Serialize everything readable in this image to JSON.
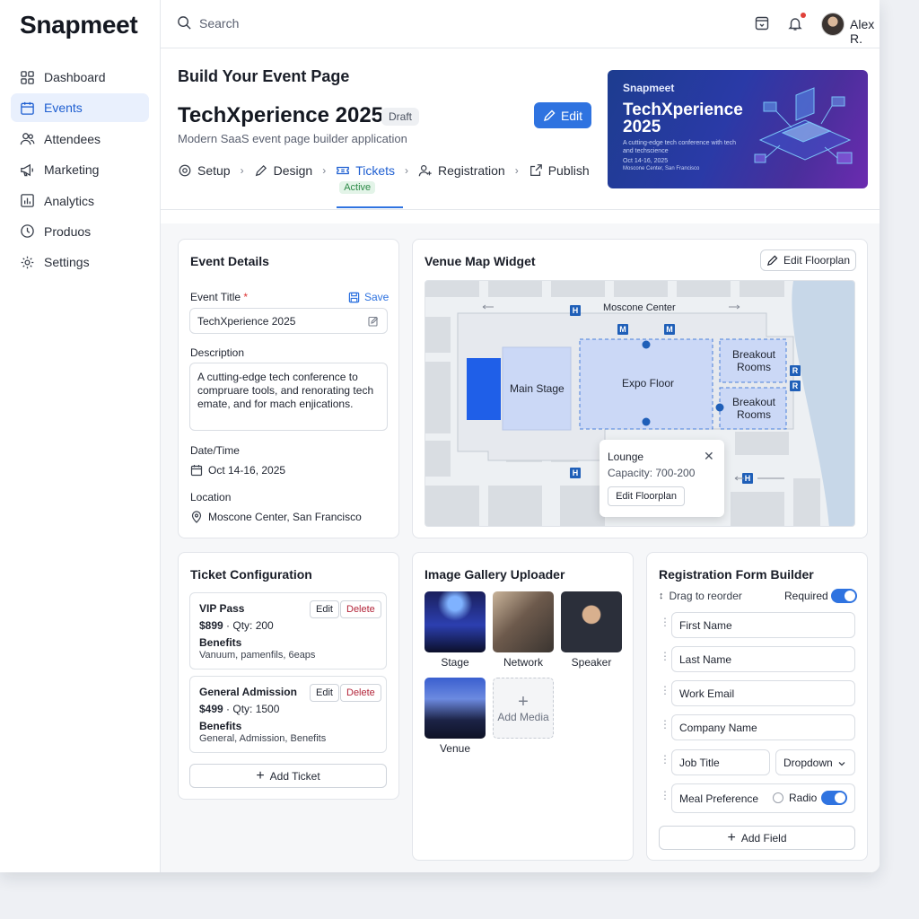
{
  "app": {
    "brand": "Snapmeet"
  },
  "sidebar": {
    "items": [
      {
        "label": "Dashboard",
        "icon": "grid-icon"
      },
      {
        "label": "Events",
        "icon": "calendar-icon",
        "active": true
      },
      {
        "label": "Attendees",
        "icon": "users-icon"
      },
      {
        "label": "Marketing",
        "icon": "megaphone-icon"
      },
      {
        "label": "Analytics",
        "icon": "chart-icon"
      },
      {
        "label": "Produos",
        "icon": "clock-icon"
      },
      {
        "label": "Settings",
        "icon": "gear-icon"
      }
    ]
  },
  "topbar": {
    "search_placeholder": "Search",
    "user_name": "Alex R."
  },
  "header": {
    "build_title": "Build Your Event Page",
    "event_title": "TechXperience 2025",
    "status_badge": "Draft",
    "subtitle": "Modern SaaS event page builder application",
    "edit_label": "Edit",
    "steps": [
      "Setup",
      "Design",
      "Tickets",
      "Registration",
      "Publish"
    ],
    "active_step_badge": "Active"
  },
  "banner": {
    "brand": "Snapmeet",
    "title": "TechXperience 2025",
    "subtitle": "A cutting-edge tech conference with tech and techscience",
    "date": "Oct 14-16, 2025",
    "venue": "Moscone Center, San Francisco"
  },
  "event_details": {
    "title": "Event Details",
    "event_title_label": "Event Title",
    "required_mark": "*",
    "save_label": "Save",
    "event_title_value": "TechXperience 2025",
    "description_label": "Description",
    "description_value": "A cutting-edge tech conference to compruare tools, and renorating tech emate, and for mach enjications.",
    "datetime_label": "Date/Time",
    "datetime_value": "Oct 14-16, 2025",
    "location_label": "Location",
    "location_value": "Moscone Center, San Francisco"
  },
  "venue_map": {
    "title": "Venue Map Widget",
    "edit_floorplan_label": "Edit Floorplan",
    "street_label": "Moscone Center",
    "zones": [
      "Main Stage",
      "Expo Floor",
      "Breakout Rooms",
      "Breakout Rooms"
    ],
    "popup": {
      "title": "Lounge",
      "capacity": "Capacity: 700-200",
      "button": "Edit Floorplan"
    }
  },
  "tickets": {
    "title": "Ticket Configuration",
    "items": [
      {
        "name": "VIP Pass",
        "price": "$899",
        "qty": " · Qty: 200",
        "benefits_label": "Benefits",
        "benefits": "Vanuum, pamenfils, 6eaps"
      },
      {
        "name": "General Admission",
        "price": "$499",
        "qty": " · Qty: 1500",
        "benefits_label": "Benefits",
        "benefits": "General, Admission, Benefits"
      }
    ],
    "edit_label": "Edit",
    "delete_label": "Delete",
    "add_label": "Add Ticket"
  },
  "gallery": {
    "title": "Image Gallery Uploader",
    "images": [
      "Stage",
      "Network",
      "Speaker",
      "Venue"
    ],
    "add_label": "Add Media"
  },
  "registration": {
    "title": "Registration Form Builder",
    "drag_hint": "Drag to reorder",
    "required_label": "Required",
    "fields": [
      "First Name",
      "Last Name",
      "Work Email",
      "Company Name",
      "Job Title",
      "Meal Preference"
    ],
    "job_type": "Dropdown",
    "meal_type": "Radio",
    "add_label": "Add Field"
  },
  "colors": {
    "accent": "#2f73e0",
    "brand_text": "#141821",
    "banner_start": "#1d3c8f",
    "banner_end": "#6c2bb0"
  }
}
